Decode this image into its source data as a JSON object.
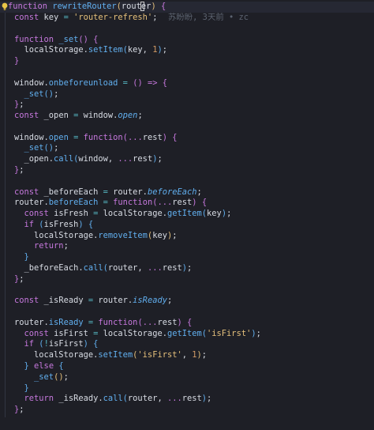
{
  "editor": {
    "blame": "苏盼盼, 3天前 • zc",
    "lines": [
      [
        [
          "kw",
          "f"
        ],
        [
          "kw",
          "unction "
        ],
        [
          "fn",
          "rewriteRouter"
        ],
        [
          "br-y",
          "("
        ],
        [
          "pl",
          "router"
        ],
        [
          "br-y",
          ")"
        ],
        [
          "pl",
          " "
        ],
        [
          "br-p",
          "{"
        ]
      ],
      [
        [
          "kw",
          "const "
        ],
        [
          "pl",
          "key "
        ],
        [
          "op",
          "= "
        ],
        [
          "str",
          "'router-refresh'"
        ],
        [
          "pl",
          ";"
        ]
      ],
      [],
      [
        [
          "kw",
          "function "
        ],
        [
          "fn",
          "_set"
        ],
        [
          "br-p",
          "()"
        ],
        [
          "pl",
          " "
        ],
        [
          "br-p",
          "{"
        ]
      ],
      [
        [
          "pl",
          "  localStorage."
        ],
        [
          "fn",
          "setItem"
        ],
        [
          "br-b",
          "("
        ],
        [
          "pl",
          "key, "
        ],
        [
          "num",
          "1"
        ],
        [
          "br-b",
          ")"
        ],
        [
          "pl",
          ";"
        ]
      ],
      [
        [
          "br-p",
          "}"
        ]
      ],
      [],
      [
        [
          "pl",
          "window."
        ],
        [
          "prop",
          "onbeforeunload"
        ],
        [
          "pl",
          " "
        ],
        [
          "op",
          "="
        ],
        [
          "pl",
          " "
        ],
        [
          "br-p",
          "()"
        ],
        [
          "pl",
          " "
        ],
        [
          "kw",
          "=>"
        ],
        [
          "pl",
          " "
        ],
        [
          "br-p",
          "{"
        ]
      ],
      [
        [
          "pl",
          "  "
        ],
        [
          "fn",
          "_set"
        ],
        [
          "br-b",
          "()"
        ],
        [
          "pl",
          ";"
        ]
      ],
      [
        [
          "br-p",
          "}"
        ],
        [
          "pl",
          ";"
        ]
      ],
      [
        [
          "kw",
          "const "
        ],
        [
          "pl",
          "_open "
        ],
        [
          "op",
          "="
        ],
        [
          "pl",
          " window."
        ],
        [
          "prop",
          "it:open"
        ],
        [
          "pl",
          ";"
        ]
      ],
      [],
      [
        [
          "pl",
          "window."
        ],
        [
          "prop",
          "open"
        ],
        [
          "pl",
          " "
        ],
        [
          "op",
          "="
        ],
        [
          "pl",
          " "
        ],
        [
          "kw",
          "function"
        ],
        [
          "br-p",
          "("
        ],
        [
          "kw",
          "..."
        ],
        [
          "pl",
          "rest"
        ],
        [
          "br-p",
          ")"
        ],
        [
          "pl",
          " "
        ],
        [
          "br-p",
          "{"
        ]
      ],
      [
        [
          "pl",
          "  "
        ],
        [
          "fn",
          "_set"
        ],
        [
          "br-b",
          "()"
        ],
        [
          "pl",
          ";"
        ]
      ],
      [
        [
          "pl",
          "  _open."
        ],
        [
          "fn",
          "call"
        ],
        [
          "br-b",
          "("
        ],
        [
          "pl",
          "window, "
        ],
        [
          "kw",
          "..."
        ],
        [
          "pl",
          "rest"
        ],
        [
          "br-b",
          ")"
        ],
        [
          "pl",
          ";"
        ]
      ],
      [
        [
          "br-p",
          "}"
        ],
        [
          "pl",
          ";"
        ]
      ],
      [],
      [
        [
          "kw",
          "const "
        ],
        [
          "pl",
          "_beforeEach "
        ],
        [
          "op",
          "="
        ],
        [
          "pl",
          " router."
        ],
        [
          "prop",
          "it:beforeEach"
        ],
        [
          "pl",
          ";"
        ]
      ],
      [
        [
          "pl",
          "router."
        ],
        [
          "prop",
          "beforeEach"
        ],
        [
          "pl",
          " "
        ],
        [
          "op",
          "="
        ],
        [
          "pl",
          " "
        ],
        [
          "kw",
          "function"
        ],
        [
          "br-p",
          "("
        ],
        [
          "kw",
          "..."
        ],
        [
          "pl",
          "rest"
        ],
        [
          "br-p",
          ")"
        ],
        [
          "pl",
          " "
        ],
        [
          "br-p",
          "{"
        ]
      ],
      [
        [
          "pl",
          "  "
        ],
        [
          "kw",
          "const "
        ],
        [
          "pl",
          "isFresh "
        ],
        [
          "op",
          "="
        ],
        [
          "pl",
          " localStorage."
        ],
        [
          "fn",
          "getItem"
        ],
        [
          "br-b",
          "("
        ],
        [
          "pl",
          "key"
        ],
        [
          "br-b",
          ")"
        ],
        [
          "pl",
          ";"
        ]
      ],
      [
        [
          "pl",
          "  "
        ],
        [
          "kw",
          "if "
        ],
        [
          "br-b",
          "("
        ],
        [
          "pl",
          "isFresh"
        ],
        [
          "br-b",
          ")"
        ],
        [
          "pl",
          " "
        ],
        [
          "br-b",
          "{"
        ]
      ],
      [
        [
          "pl",
          "    localStorage."
        ],
        [
          "fn",
          "removeItem"
        ],
        [
          "br-y",
          "("
        ],
        [
          "pl",
          "key"
        ],
        [
          "br-y",
          ")"
        ],
        [
          "pl",
          ";"
        ]
      ],
      [
        [
          "pl",
          "    "
        ],
        [
          "kw",
          "return"
        ],
        [
          "pl",
          ";"
        ]
      ],
      [
        [
          "pl",
          "  "
        ],
        [
          "br-b",
          "}"
        ]
      ],
      [
        [
          "pl",
          "  _beforeEach."
        ],
        [
          "fn",
          "call"
        ],
        [
          "br-b",
          "("
        ],
        [
          "pl",
          "router, "
        ],
        [
          "kw",
          "..."
        ],
        [
          "pl",
          "rest"
        ],
        [
          "br-b",
          ")"
        ],
        [
          "pl",
          ";"
        ]
      ],
      [
        [
          "br-p",
          "}"
        ],
        [
          "pl",
          ";"
        ]
      ],
      [],
      [
        [
          "kw",
          "const "
        ],
        [
          "pl",
          "_isReady "
        ],
        [
          "op",
          "="
        ],
        [
          "pl",
          " router."
        ],
        [
          "prop",
          "it:isReady"
        ],
        [
          "pl",
          ";"
        ]
      ],
      [],
      [
        [
          "pl",
          "router."
        ],
        [
          "prop",
          "isReady"
        ],
        [
          "pl",
          " "
        ],
        [
          "op",
          "="
        ],
        [
          "pl",
          " "
        ],
        [
          "kw",
          "function"
        ],
        [
          "br-p",
          "("
        ],
        [
          "kw",
          "..."
        ],
        [
          "pl",
          "rest"
        ],
        [
          "br-p",
          ")"
        ],
        [
          "pl",
          " "
        ],
        [
          "br-p",
          "{"
        ]
      ],
      [
        [
          "pl",
          "  "
        ],
        [
          "kw",
          "const "
        ],
        [
          "pl",
          "isFirst "
        ],
        [
          "op",
          "="
        ],
        [
          "pl",
          " localStorage."
        ],
        [
          "fn",
          "getItem"
        ],
        [
          "br-b",
          "("
        ],
        [
          "str",
          "'isFirst'"
        ],
        [
          "br-b",
          ")"
        ],
        [
          "pl",
          ";"
        ]
      ],
      [
        [
          "pl",
          "  "
        ],
        [
          "kw",
          "if "
        ],
        [
          "br-b",
          "("
        ],
        [
          "op",
          "!"
        ],
        [
          "pl",
          "isFirst"
        ],
        [
          "br-b",
          ")"
        ],
        [
          "pl",
          " "
        ],
        [
          "br-b",
          "{"
        ]
      ],
      [
        [
          "pl",
          "    localStorage."
        ],
        [
          "fn",
          "setItem"
        ],
        [
          "br-y",
          "("
        ],
        [
          "str",
          "'isFirst'"
        ],
        [
          "pl",
          ", "
        ],
        [
          "num",
          "1"
        ],
        [
          "br-y",
          ")"
        ],
        [
          "pl",
          ";"
        ]
      ],
      [
        [
          "pl",
          "  "
        ],
        [
          "br-b",
          "}"
        ],
        [
          "pl",
          " "
        ],
        [
          "kw",
          "else "
        ],
        [
          "br-b",
          "{"
        ]
      ],
      [
        [
          "pl",
          "    "
        ],
        [
          "fn",
          "_set"
        ],
        [
          "br-y",
          "()"
        ],
        [
          "pl",
          ";"
        ]
      ],
      [
        [
          "pl",
          "  "
        ],
        [
          "br-b",
          "}"
        ]
      ],
      [
        [
          "pl",
          "  "
        ],
        [
          "kw",
          "return "
        ],
        [
          "pl",
          "_isReady."
        ],
        [
          "fn",
          "call"
        ],
        [
          "br-b",
          "("
        ],
        [
          "pl",
          "router, "
        ],
        [
          "kw",
          "..."
        ],
        [
          "pl",
          "rest"
        ],
        [
          "br-b",
          ")"
        ],
        [
          "pl",
          ";"
        ]
      ],
      [
        [
          "br-p",
          "}"
        ],
        [
          "pl",
          ";"
        ]
      ]
    ]
  }
}
